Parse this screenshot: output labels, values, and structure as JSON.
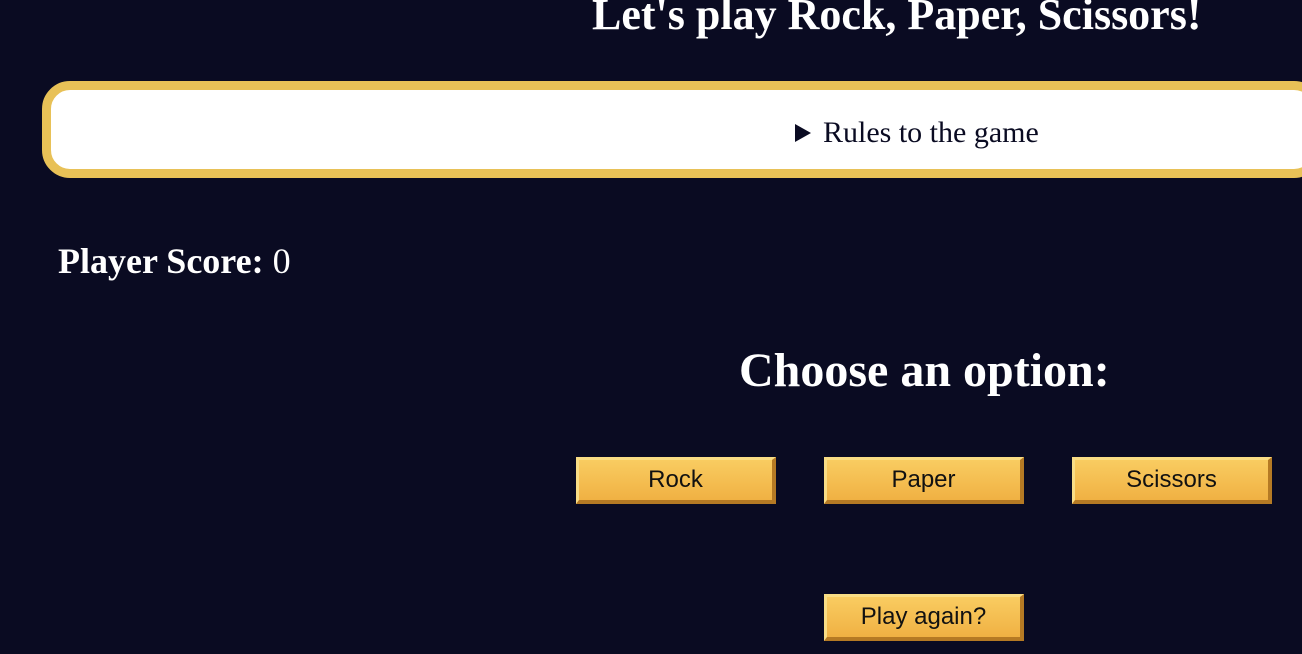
{
  "header": {
    "title": "Let's play Rock, Paper, Scissors!"
  },
  "rules": {
    "summary": "Rules to the game",
    "icon": "triangle-right-icon",
    "border_color": "#e8c157"
  },
  "score": {
    "label": "Player Score:",
    "value": "0"
  },
  "choices": {
    "heading": "Choose an option:",
    "rock": "Rock",
    "paper": "Paper",
    "scissors": "Scissors"
  },
  "actions": {
    "play_again": "Play again?"
  },
  "colors": {
    "background": "#0a0b22",
    "button": "#f4bd4f",
    "text": "#ffffff"
  }
}
